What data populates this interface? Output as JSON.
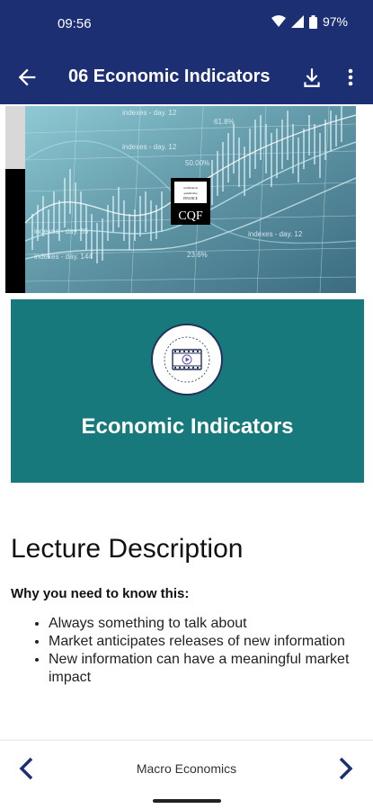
{
  "status_bar": {
    "time": "09:56",
    "battery": "97%",
    "icons": [
      "wifi-icon",
      "signal-icon",
      "battery-icon"
    ]
  },
  "app_bar": {
    "title": "06 Economic Indicators",
    "icons": [
      "back-arrow-icon",
      "download-icon",
      "more-vert-icon"
    ]
  },
  "hero": {
    "logo_text": "CQF",
    "logo_subtext": "certificate in quantitative finance",
    "chart_overlay_labels": [
      "indexes - day. 12",
      "indexes - day. 55",
      "indexes - day. 144",
      "61.8%",
      "50.00%",
      "23.6%"
    ]
  },
  "video_card": {
    "title": "Economic Indicators",
    "background": "#17797b"
  },
  "description": {
    "heading": "Lecture Description",
    "subheading": "Why you need to know this:",
    "bullets": [
      "Always something to talk about",
      "Market anticipates releases of new information",
      "New information can have a meaningful market impact"
    ]
  },
  "bottom_nav": {
    "course_name": "Macro Economics",
    "icons": [
      "chevron-left-icon",
      "chevron-right-icon"
    ]
  },
  "colors": {
    "primary": "#1c2f73",
    "accent": "#17797b"
  }
}
